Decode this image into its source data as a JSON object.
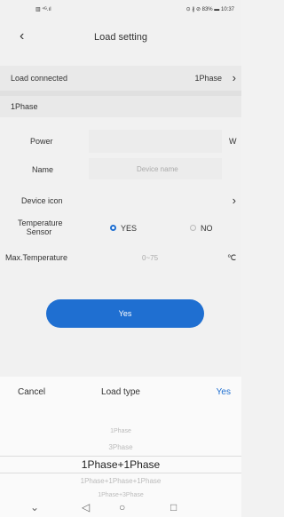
{
  "status_bar": {
    "left": "▥ ⁴ᴳ.ıl",
    "right": "⊙ ∦ ⊘ 83% ▬ 10:37"
  },
  "header": {
    "title": "Load setting"
  },
  "load_connected": {
    "label": "Load connected",
    "value": "1Phase"
  },
  "section_label": "1Phase",
  "form": {
    "power_label": "Power",
    "power_unit": "W",
    "name_label": "Name",
    "name_placeholder": "Device name",
    "device_icon_label": "Device icon",
    "temp_sensor_label": "Temperature\nSensor",
    "temp_sensor_yes": "YES",
    "temp_sensor_no": "NO",
    "max_temp_label": "Max.Temperature",
    "max_temp_placeholder": "0~75",
    "max_temp_unit": "℃"
  },
  "primary_button": "Yes",
  "picker": {
    "cancel": "Cancel",
    "title": "Load type",
    "confirm": "Yes",
    "items": [
      "1Phase",
      "3Phase",
      "1Phase+1Phase",
      "1Phase+1Phase+1Phase",
      "1Phase+3Phase"
    ],
    "selected_index": 2
  },
  "nav_bar": {
    "chevron": "⌄",
    "back": "◁",
    "home": "○",
    "recent": "□"
  }
}
